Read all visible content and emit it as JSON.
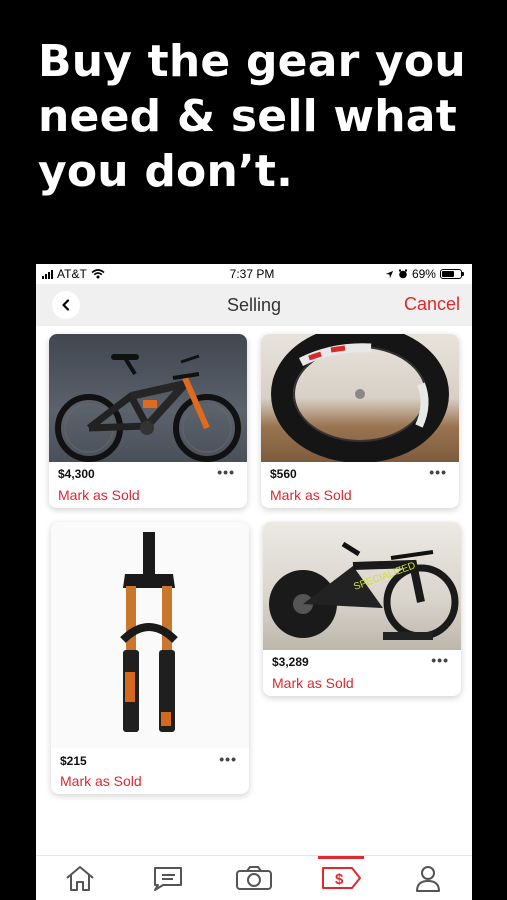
{
  "promo": {
    "line1": "Buy the gear you",
    "line2": "need & sell what",
    "line3": "you don’t."
  },
  "status_bar": {
    "carrier": "AT&T",
    "time": "7:37 PM",
    "battery": "69%",
    "battery_level": 0.69
  },
  "nav": {
    "title": "Selling",
    "cancel_label": "Cancel",
    "back_icon": "chevron-left-icon"
  },
  "listings": [
    {
      "price": "$4,300",
      "action": "Mark as Sold",
      "more_label": "•••",
      "image": "mountain-bike-photo"
    },
    {
      "price": "$560",
      "action": "Mark as Sold",
      "more_label": "•••",
      "image": "carbon-wheel-photo"
    },
    {
      "price": "$215",
      "action": "Mark as Sold",
      "more_label": "•••",
      "image": "suspension-fork-photo"
    },
    {
      "price": "$3,289",
      "action": "Mark as Sold",
      "more_label": "•••",
      "image": "triathlon-bike-photo"
    }
  ],
  "tabs": [
    {
      "icon": "home-icon",
      "active": false
    },
    {
      "icon": "chat-icon",
      "active": false
    },
    {
      "icon": "camera-icon",
      "active": false
    },
    {
      "icon": "price-tag-icon",
      "active": true
    },
    {
      "icon": "profile-icon",
      "active": false
    }
  ],
  "colors": {
    "accent": "#e0282e",
    "background": "#000000",
    "nav_bg": "#f0f0f0"
  }
}
